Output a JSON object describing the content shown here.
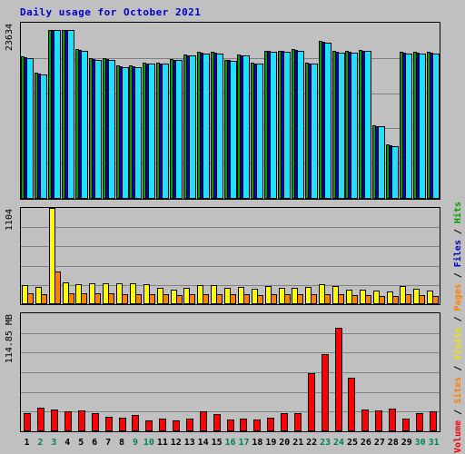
{
  "title": "Daily usage for October 2021",
  "axis": {
    "hits_max_label": "23634",
    "visits_max_label": "1104",
    "volume_max_label": "114.85 MB"
  },
  "legend": {
    "volume": "Volume",
    "sites": "Sites",
    "visits": "Visits",
    "pages": "Pages",
    "files": "Files",
    "hits": "Hits",
    "separator": " / "
  },
  "colors": {
    "hits": "#00a000",
    "files": "#0000c0",
    "pages": "#20e0ff",
    "visits": "#ffff00",
    "sites": "#ff8000",
    "volume": "#ff0000",
    "title": "#0000cc",
    "weekend": "#008060",
    "background": "#c0c0c0",
    "grid": "#808080"
  },
  "chart_data": {
    "type": "bar",
    "title": "Daily usage for October 2021",
    "xlabel": "",
    "categories": [
      "1",
      "2",
      "3",
      "4",
      "5",
      "6",
      "7",
      "8",
      "9",
      "10",
      "11",
      "12",
      "13",
      "14",
      "15",
      "16",
      "17",
      "18",
      "19",
      "20",
      "21",
      "22",
      "23",
      "24",
      "25",
      "26",
      "27",
      "28",
      "29",
      "30",
      "31"
    ],
    "weekend_days": [
      2,
      3,
      9,
      10,
      16,
      17,
      23,
      24,
      30,
      31
    ],
    "panels": [
      {
        "name": "hits-files-pages",
        "ylabel": "Hits",
        "ylim": [
          0,
          23634
        ],
        "ymax_label": "23634",
        "gridlines": 4,
        "series": [
          {
            "name": "Hits",
            "color": "#00a000",
            "values": [
              19100,
              16900,
              22700,
              22700,
              20100,
              18900,
              18900,
              17900,
              17900,
              18300,
              18300,
              18800,
              19400,
              19700,
              19700,
              18700,
              19400,
              18300,
              19900,
              19900,
              20100,
              18300,
              21200,
              19800,
              19800,
              20000,
              9900,
              7300,
              19700,
              19700,
              19700
            ]
          },
          {
            "name": "Files",
            "color": "#0000c0",
            "values": [
              19000,
              16800,
              22600,
              22600,
              20000,
              18800,
              18800,
              17800,
              17800,
              18200,
              18200,
              18700,
              19300,
              19600,
              19600,
              18600,
              19300,
              18200,
              19800,
              19800,
              20000,
              18200,
              21100,
              19700,
              19700,
              19900,
              9800,
              7200,
              19600,
              19600,
              19600
            ]
          },
          {
            "name": "Pages",
            "color": "#20e0ff",
            "values": [
              18900,
              16700,
              22600,
              22600,
              19900,
              18700,
              18700,
              17700,
              17700,
              18100,
              18100,
              18600,
              19200,
              19500,
              19500,
              18500,
              19200,
              18100,
              19700,
              19700,
              19900,
              18100,
              21000,
              19600,
              19600,
              19800,
              9700,
              7100,
              19500,
              19500,
              19500
            ]
          }
        ]
      },
      {
        "name": "visits-sites",
        "ylabel": "Visits",
        "ylim": [
          0,
          1104
        ],
        "ymax_label": "1104",
        "gridlines": 4,
        "series": [
          {
            "name": "Visits",
            "color": "#ffff00",
            "values": [
              222,
              196,
              1104,
              250,
              232,
              240,
              240,
              240,
              240,
              232,
              184,
              170,
              190,
              222,
              222,
              190,
              196,
              180,
              210,
              190,
              190,
              196,
              230,
              210,
              165,
              165,
              160,
              148,
              205,
              175,
              160
            ]
          },
          {
            "name": "Sites",
            "color": "#ff8000",
            "values": [
              120,
              118,
              380,
              122,
              120,
              120,
              120,
              118,
              118,
              118,
              110,
              108,
              110,
              118,
              118,
              110,
              112,
              108,
              115,
              110,
              110,
              112,
              118,
              112,
              100,
              100,
              98,
              92,
              110,
              100,
              96
            ]
          }
        ]
      },
      {
        "name": "volume",
        "ylabel": "Volume",
        "ylim": [
          0,
          114.85
        ],
        "ymax_label": "114.85 MB",
        "unit": "MB",
        "gridlines": 5,
        "series": [
          {
            "name": "Volume",
            "color": "#ff0000",
            "values": [
              17.5,
              23.0,
              21.5,
              19.5,
              20.0,
              17.5,
              14.0,
              13.5,
              15.5,
              10.5,
              12.5,
              11.0,
              12.0,
              19.5,
              17.0,
              11.5,
              12.0,
              11.5,
              13.0,
              18.0,
              17.5,
              56.5,
              75.5,
              100.5,
              52.0,
              21.0,
              20.5,
              22.0,
              12.0,
              17.5,
              19.0
            ]
          }
        ]
      }
    ]
  }
}
